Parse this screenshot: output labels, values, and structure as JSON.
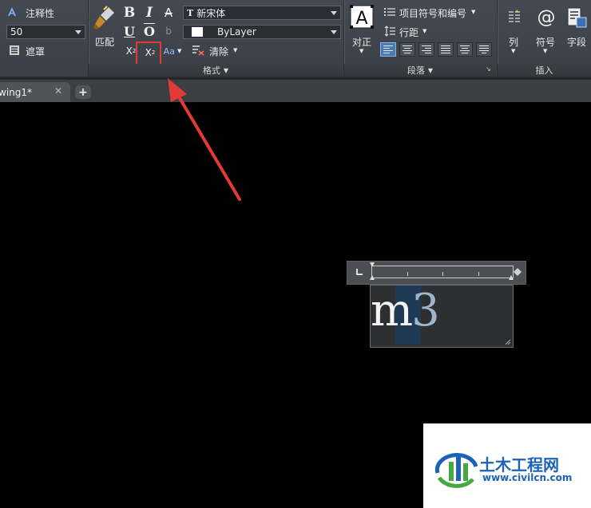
{
  "ribbon": {
    "annotative_label": "注释性",
    "text_height_value": "50",
    "mask_label": "遮罩",
    "match_label": "匹配",
    "bold_glyph": "B",
    "italic_glyph": "I",
    "strike_glyph": "A",
    "underline_glyph": "U",
    "overline_glyph": "O",
    "stack_glyph": "b",
    "superscript_glyph": "X",
    "superscript_mark": "2",
    "subscript_glyph": "X",
    "subscript_mark": "2",
    "case_glyph": "Aa",
    "font_value": "新宋体",
    "font_prefix": "T",
    "color_value": "ByLayer",
    "clear_label": "清除",
    "format_panel_label": "格式",
    "justify_label": "对正",
    "bullets_label": "项目符号和编号",
    "line_spacing_label": "行距",
    "paragraph_panel_label": "段落",
    "column_label": "列",
    "symbol_label": "符号",
    "symbol_glyph": "@",
    "field_label": "字段",
    "insert_panel_label": "插入"
  },
  "tabs": {
    "doc_tab_label": "wing1*",
    "close_glyph": "✕",
    "new_tab_glyph": "+"
  },
  "editor": {
    "text_main": "m",
    "text_selected": "3"
  },
  "watermark": {
    "title": "土木工程网",
    "url": "www.civilcn.com"
  },
  "colors": {
    "highlight_box": "#e23b34",
    "arrow": "#e23b34",
    "watermark_blue": "#1b62b8"
  }
}
